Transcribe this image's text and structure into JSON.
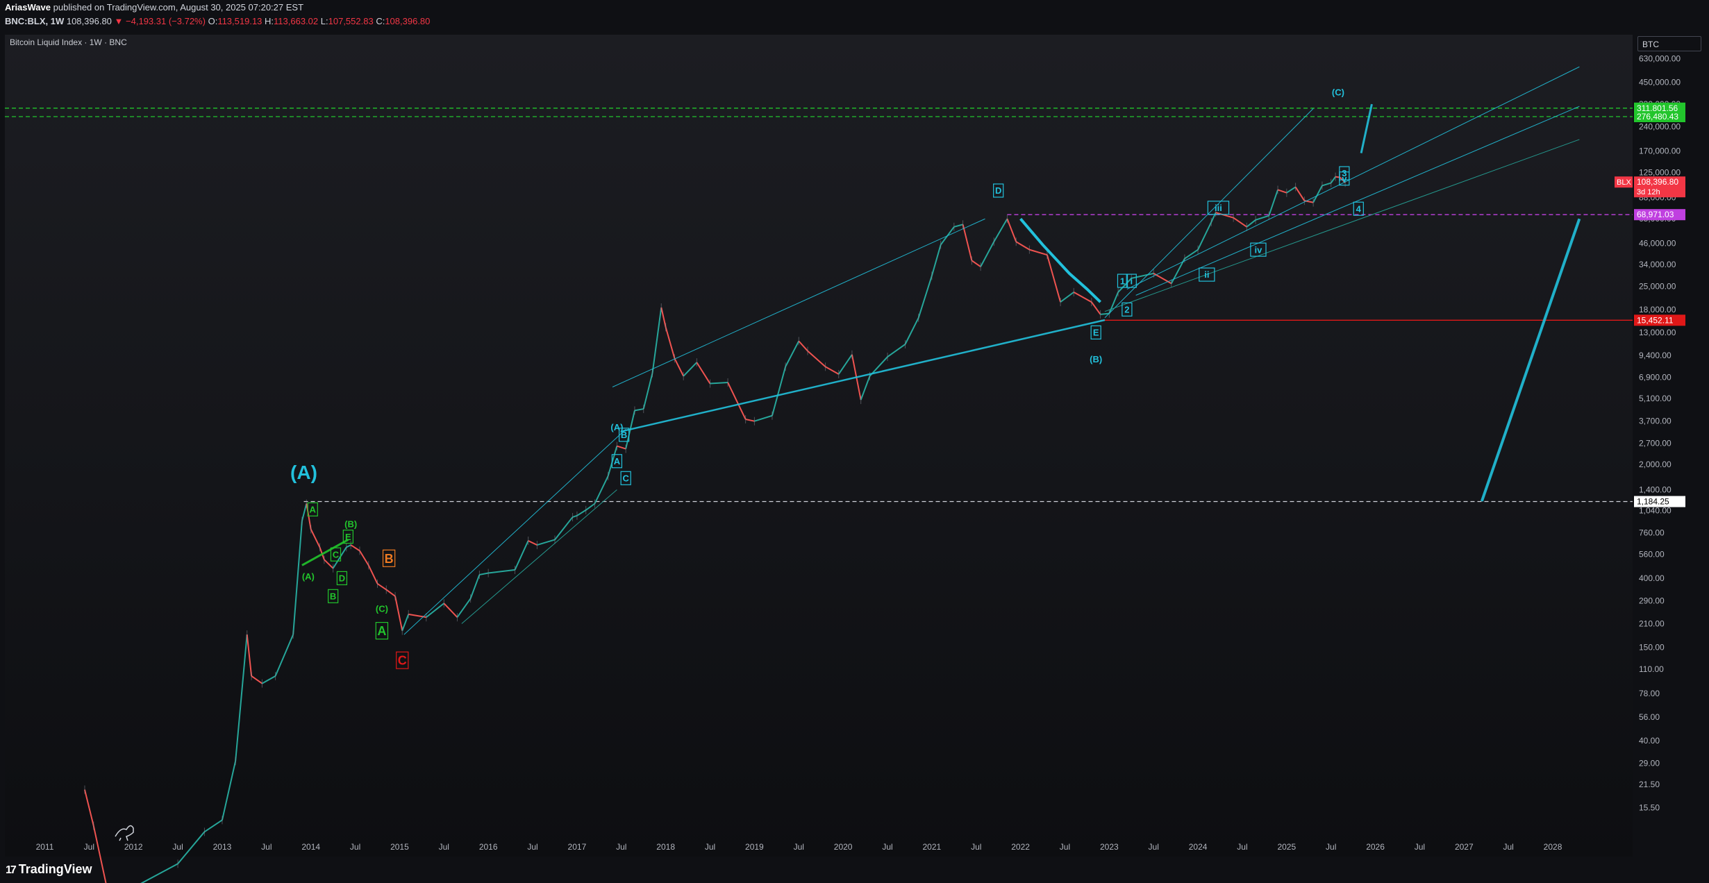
{
  "header": {
    "author": "AriasWave",
    "published_text": "published on TradingView.com, August 30, 2025 07:20:27 EST",
    "symbol_line": {
      "symbol": "BNC:BLX, 1W",
      "price": "108,396.80",
      "change": "▼ −4,193.31 (−3.72%)",
      "o_label": "O:",
      "o": "113,519.13",
      "h_label": "H:",
      "h": "113,663.02",
      "l_label": "L:",
      "l": "107,552.83",
      "c_label": "C:",
      "c": "108,396.80"
    }
  },
  "chart_title": "Bitcoin Liquid Index · 1W · BNC",
  "symbol_box": "BTC",
  "footer": {
    "brand": "TradingView"
  },
  "colors": {
    "up": "#26a69a",
    "down": "#ef5350",
    "cyan": "#22c1dc",
    "green": "#22c52c",
    "orange": "#f07b22",
    "red": "#e01818",
    "magenta": "#c040e0",
    "price_tag": "#f23645"
  },
  "chart_data": {
    "type": "line",
    "subtype": "candlestick-approximation",
    "scale": "log",
    "ylim": [
      10,
      900000
    ],
    "x_range": [
      "2010-07-01",
      "2028-12-31"
    ],
    "y_ticks": [
      "630,000.00",
      "450,000.00",
      "330,000.00",
      "240,000.00",
      "170,000.00",
      "125,000.00",
      "88,000.00",
      "65,000.00",
      "46,000.00",
      "34,000.00",
      "25,000.00",
      "18,000.00",
      "13,000.00",
      "9,400.00",
      "6,900.00",
      "5,100.00",
      "3,700.00",
      "2,700.00",
      "2,000.00",
      "1,400.00",
      "1,040.00",
      "760.00",
      "560.00",
      "400.00",
      "290.00",
      "210.00",
      "150.00",
      "110.00",
      "78.00",
      "56.00",
      "40.00",
      "29.00",
      "21.50",
      "15.50"
    ],
    "y_tick_values": [
      630000,
      450000,
      330000,
      240000,
      170000,
      125000,
      88000,
      65000,
      46000,
      34000,
      25000,
      18000,
      13000,
      9400,
      6900,
      5100,
      3700,
      2700,
      2000,
      1400,
      1040,
      760,
      560,
      400,
      290,
      210,
      150,
      110,
      78,
      56,
      40,
      29,
      21.5,
      15.5
    ],
    "x_ticks": [
      {
        "label": "2011",
        "t": 2011.0
      },
      {
        "label": "Jul",
        "t": 2011.5
      },
      {
        "label": "2012",
        "t": 2012.0
      },
      {
        "label": "Jul",
        "t": 2012.5
      },
      {
        "label": "2013",
        "t": 2013.0
      },
      {
        "label": "Jul",
        "t": 2013.5
      },
      {
        "label": "2014",
        "t": 2014.0
      },
      {
        "label": "Jul",
        "t": 2014.5
      },
      {
        "label": "2015",
        "t": 2015.0
      },
      {
        "label": "Jul",
        "t": 2015.5
      },
      {
        "label": "2016",
        "t": 2016.0
      },
      {
        "label": "Jul",
        "t": 2016.5
      },
      {
        "label": "2017",
        "t": 2017.0
      },
      {
        "label": "Jul",
        "t": 2017.5
      },
      {
        "label": "2018",
        "t": 2018.0
      },
      {
        "label": "Jul",
        "t": 2018.5
      },
      {
        "label": "2019",
        "t": 2019.0
      },
      {
        "label": "Jul",
        "t": 2019.5
      },
      {
        "label": "2020",
        "t": 2020.0
      },
      {
        "label": "Jul",
        "t": 2020.5
      },
      {
        "label": "2021",
        "t": 2021.0
      },
      {
        "label": "Jul",
        "t": 2021.5
      },
      {
        "label": "2022",
        "t": 2022.0
      },
      {
        "label": "Jul",
        "t": 2022.5
      },
      {
        "label": "2023",
        "t": 2023.0
      },
      {
        "label": "Jul",
        "t": 2023.5
      },
      {
        "label": "2024",
        "t": 2024.0
      },
      {
        "label": "Jul",
        "t": 2024.5
      },
      {
        "label": "2025",
        "t": 2025.0
      },
      {
        "label": "Jul",
        "t": 2025.5
      },
      {
        "label": "2026",
        "t": 2026.0
      },
      {
        "label": "Jul",
        "t": 2026.5
      },
      {
        "label": "2027",
        "t": 2027.0
      },
      {
        "label": "Jul",
        "t": 2027.5
      },
      {
        "label": "2028",
        "t": 2028.0
      }
    ],
    "series": [
      {
        "values_note": "approximate weekly closing prices (decimal year, USD)",
        "points": [
          [
            2011.45,
            20
          ],
          [
            2011.55,
            12
          ],
          [
            2011.7,
            5
          ],
          [
            2012.0,
            5
          ],
          [
            2012.5,
            7
          ],
          [
            2012.8,
            11
          ],
          [
            2013.0,
            13
          ],
          [
            2013.15,
            30
          ],
          [
            2013.28,
            180
          ],
          [
            2013.33,
            100
          ],
          [
            2013.45,
            90
          ],
          [
            2013.6,
            100
          ],
          [
            2013.8,
            180
          ],
          [
            2013.9,
            900
          ],
          [
            2013.95,
            1150
          ],
          [
            2014.0,
            800
          ],
          [
            2014.1,
            620
          ],
          [
            2014.15,
            520
          ],
          [
            2014.25,
            460
          ],
          [
            2014.4,
            620
          ],
          [
            2014.45,
            640
          ],
          [
            2014.55,
            590
          ],
          [
            2014.65,
            480
          ],
          [
            2014.75,
            370
          ],
          [
            2014.85,
            340
          ],
          [
            2014.95,
            310
          ],
          [
            2015.03,
            190
          ],
          [
            2015.1,
            240
          ],
          [
            2015.3,
            230
          ],
          [
            2015.5,
            280
          ],
          [
            2015.65,
            230
          ],
          [
            2015.8,
            300
          ],
          [
            2015.9,
            420
          ],
          [
            2016.0,
            430
          ],
          [
            2016.3,
            450
          ],
          [
            2016.45,
            680
          ],
          [
            2016.55,
            640
          ],
          [
            2016.75,
            690
          ],
          [
            2016.95,
            950
          ],
          [
            2017.0,
            970
          ],
          [
            2017.1,
            1050
          ],
          [
            2017.2,
            1150
          ],
          [
            2017.35,
            1700
          ],
          [
            2017.45,
            2600
          ],
          [
            2017.55,
            2500
          ],
          [
            2017.65,
            4300
          ],
          [
            2017.75,
            4400
          ],
          [
            2017.85,
            7300
          ],
          [
            2017.95,
            18500
          ],
          [
            2018.0,
            14000
          ],
          [
            2018.1,
            9000
          ],
          [
            2018.2,
            7000
          ],
          [
            2018.35,
            8500
          ],
          [
            2018.5,
            6300
          ],
          [
            2018.7,
            6400
          ],
          [
            2018.9,
            3800
          ],
          [
            2019.0,
            3700
          ],
          [
            2019.2,
            4000
          ],
          [
            2019.35,
            8000
          ],
          [
            2019.5,
            11500
          ],
          [
            2019.6,
            10000
          ],
          [
            2019.8,
            8000
          ],
          [
            2019.95,
            7200
          ],
          [
            2020.1,
            9500
          ],
          [
            2020.2,
            5000
          ],
          [
            2020.3,
            7000
          ],
          [
            2020.5,
            9200
          ],
          [
            2020.7,
            11000
          ],
          [
            2020.85,
            16000
          ],
          [
            2021.0,
            29000
          ],
          [
            2021.1,
            45000
          ],
          [
            2021.25,
            58000
          ],
          [
            2021.35,
            60000
          ],
          [
            2021.45,
            36000
          ],
          [
            2021.55,
            33000
          ],
          [
            2021.7,
            47000
          ],
          [
            2021.85,
            65000
          ],
          [
            2021.95,
            47000
          ],
          [
            2022.1,
            42000
          ],
          [
            2022.3,
            39000
          ],
          [
            2022.45,
            20000
          ],
          [
            2022.6,
            23000
          ],
          [
            2022.8,
            20000
          ],
          [
            2022.9,
            16800
          ],
          [
            2023.0,
            17000
          ],
          [
            2023.1,
            23000
          ],
          [
            2023.25,
            28000
          ],
          [
            2023.5,
            30000
          ],
          [
            2023.7,
            26000
          ],
          [
            2023.85,
            37000
          ],
          [
            2024.0,
            42000
          ],
          [
            2024.15,
            62000
          ],
          [
            2024.2,
            71000
          ],
          [
            2024.4,
            66000
          ],
          [
            2024.55,
            58000
          ],
          [
            2024.65,
            64000
          ],
          [
            2024.8,
            68000
          ],
          [
            2024.9,
            98000
          ],
          [
            2025.0,
            94000
          ],
          [
            2025.1,
            102000
          ],
          [
            2025.2,
            84000
          ],
          [
            2025.3,
            82000
          ],
          [
            2025.4,
            104000
          ],
          [
            2025.5,
            108000
          ],
          [
            2025.55,
            118000
          ],
          [
            2025.6,
            117000
          ],
          [
            2025.66,
            108396.8
          ]
        ]
      }
    ],
    "horizontal_levels": [
      {
        "label": "311,801.56",
        "value": 311801.56,
        "color": "#22c52c",
        "style": "dashed"
      },
      {
        "label": "276,480.43",
        "value": 276480.43,
        "color": "#22c52c",
        "style": "dashed"
      },
      {
        "label": "68,971.03",
        "value": 68971.03,
        "color": "#c040e0",
        "style": "dashed"
      },
      {
        "label": "15,452.11",
        "value": 15452.11,
        "color": "#e01818",
        "style": "solid"
      },
      {
        "label": "1,184.25",
        "value": 1184.25,
        "color": "#d1d4dc",
        "style": "dashed"
      }
    ],
    "price_tag": {
      "symbol": "BLX",
      "price": "108,396.80",
      "countdown": "3d 12h"
    },
    "annotations": [
      {
        "text": "(A)",
        "t": 2013.92,
        "p": 1800,
        "color": "#22c1dc",
        "size": "large"
      },
      {
        "text": "A",
        "t": 2014.02,
        "p": 1060,
        "color": "#22c52c",
        "box": true
      },
      {
        "text": "(B)",
        "t": 2014.45,
        "p": 860,
        "color": "#22c52c"
      },
      {
        "text": "E",
        "t": 2014.42,
        "p": 720,
        "color": "#22c52c",
        "box": true
      },
      {
        "text": "C",
        "t": 2014.28,
        "p": 560,
        "color": "#22c52c",
        "box": true
      },
      {
        "text": "(A)",
        "t": 2013.97,
        "p": 410,
        "color": "#22c52c"
      },
      {
        "text": "D",
        "t": 2014.35,
        "p": 400,
        "color": "#22c52c",
        "box": true
      },
      {
        "text": "B",
        "t": 2014.25,
        "p": 310,
        "color": "#22c52c",
        "box": true
      },
      {
        "text": "(C)",
        "t": 2014.8,
        "p": 260,
        "color": "#22c52c"
      },
      {
        "text": "A",
        "t": 2014.8,
        "p": 190,
        "color": "#22c52c",
        "box": true,
        "size": "large"
      },
      {
        "text": "B",
        "t": 2014.88,
        "p": 530,
        "color": "#f07b22",
        "box": true,
        "size": "large"
      },
      {
        "text": "C",
        "t": 2015.03,
        "p": 125,
        "color": "#e01818",
        "box": true,
        "size": "large"
      },
      {
        "text": "(A)",
        "t": 2017.45,
        "p": 3400,
        "color": "#22c1dc"
      },
      {
        "text": "B",
        "t": 2017.53,
        "p": 3050,
        "color": "#22c1dc",
        "box": true
      },
      {
        "text": "A",
        "t": 2017.45,
        "p": 2100,
        "color": "#22c1dc",
        "box": true
      },
      {
        "text": "C",
        "t": 2017.55,
        "p": 1650,
        "color": "#22c1dc",
        "box": true
      },
      {
        "text": "D",
        "t": 2021.75,
        "p": 97000,
        "color": "#22c1dc",
        "box": true
      },
      {
        "text": "E",
        "t": 2022.85,
        "p": 13000,
        "color": "#22c1dc",
        "box": true
      },
      {
        "text": "(B)",
        "t": 2022.85,
        "p": 8900,
        "color": "#22c1dc"
      },
      {
        "text": "1",
        "t": 2023.15,
        "p": 27000,
        "color": "#22c1dc",
        "box": true
      },
      {
        "text": "2",
        "t": 2023.2,
        "p": 18000,
        "color": "#22c1dc",
        "box": true
      },
      {
        "text": "i",
        "t": 2023.25,
        "p": 27000,
        "color": "#22c1dc",
        "box": true
      },
      {
        "text": "ii",
        "t": 2024.1,
        "p": 29500,
        "color": "#22c1dc",
        "box": true
      },
      {
        "text": "iii",
        "t": 2024.23,
        "p": 76000,
        "color": "#22c1dc",
        "box": true
      },
      {
        "text": "iv",
        "t": 2024.68,
        "p": 42000,
        "color": "#22c1dc",
        "box": true
      },
      {
        "text": "3",
        "t": 2025.65,
        "p": 124000,
        "color": "#22c1dc",
        "box": true
      },
      {
        "text": "v",
        "t": 2025.65,
        "p": 115000,
        "color": "#22c1dc",
        "box": true
      },
      {
        "text": "4",
        "t": 2025.81,
        "p": 75000,
        "color": "#22c1dc",
        "box": true
      },
      {
        "text": "(C)",
        "t": 2025.58,
        "p": 390000,
        "color": "#22c1dc"
      }
    ],
    "trendlines": [
      {
        "from": [
          2015.05,
          180
        ],
        "to": [
          2017.55,
          3300
        ],
        "color": "#22c1dc",
        "w": 1
      },
      {
        "from": [
          2015.7,
          210
        ],
        "to": [
          2017.45,
          1400
        ],
        "color": "#26a69a",
        "w": 1
      },
      {
        "from": [
          2017.5,
          3200
        ],
        "to": [
          2022.95,
          15500
        ],
        "color": "#22c1dc",
        "w": 2.5
      },
      {
        "from": [
          2017.4,
          6000
        ],
        "to": [
          2021.6,
          65000
        ],
        "color": "#22c1dc",
        "w": 1
      },
      {
        "from": [
          2013.9,
          480
        ],
        "to": [
          2014.42,
          690
        ],
        "color": "#22c52c",
        "w": 3
      },
      {
        "from": [
          2022.95,
          16000
        ],
        "to": [
          2025.3,
          310000
        ],
        "color": "#22c1dc",
        "w": 1
      },
      {
        "from": [
          2023.2,
          24000
        ],
        "to": [
          2028.3,
          560000
        ],
        "color": "#22c1dc",
        "w": 1
      },
      {
        "from": [
          2023.3,
          22000
        ],
        "to": [
          2028.3,
          320000
        ],
        "color": "#22c1dc",
        "w": 1
      },
      {
        "from": [
          2022.95,
          17500
        ],
        "to": [
          2028.3,
          200000
        ],
        "color": "#26a69a",
        "w": 1
      },
      {
        "from": [
          2025.84,
          165000
        ],
        "to": [
          2025.96,
          330000
        ],
        "color": "#22c1dc",
        "w": 3
      },
      {
        "from": [
          2027.2,
          1190
        ],
        "to": [
          2028.3,
          65000
        ],
        "color": "#22c1dc",
        "w": 4
      }
    ],
    "curve": [
      [
        2022.0,
        65000
      ],
      [
        2022.25,
        45000
      ],
      [
        2022.55,
        30000
      ],
      [
        2022.75,
        24000
      ],
      [
        2022.9,
        20000
      ]
    ]
  }
}
